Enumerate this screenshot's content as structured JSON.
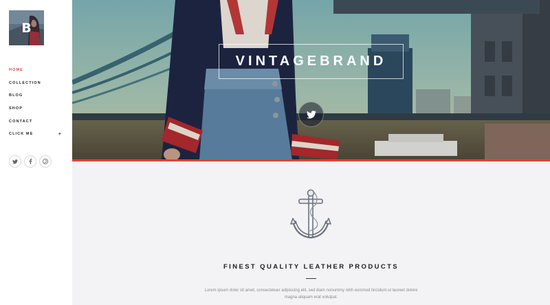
{
  "sidebar": {
    "logo_letter": "B",
    "nav": [
      {
        "label": "HOME",
        "active": true
      },
      {
        "label": "COLLECTION"
      },
      {
        "label": "BLOG"
      },
      {
        "label": "SHOP"
      },
      {
        "label": "CONTACT"
      },
      {
        "label": "CLICK ME",
        "expander": "+"
      }
    ],
    "socials": [
      {
        "icon": "twitter-icon",
        "glyph": "t"
      },
      {
        "icon": "facebook-icon",
        "glyph": "f"
      },
      {
        "icon": "pinterest-icon",
        "glyph": "p"
      }
    ]
  },
  "hero": {
    "brand": "VINTAGEBRAND",
    "button_icon": "twitter-icon",
    "accent_color": "#e0413a"
  },
  "content": {
    "icon": "anchor-icon",
    "tagline": "FINEST QUALITY LEATHER PRODUCTS",
    "body": "Lorem ipsum dolor sit amet, consectetuer adipiscing elit, sed diam nonummy nibh euismod tincidunt ut laoreet dolore magna aliquam erat volutpat."
  }
}
